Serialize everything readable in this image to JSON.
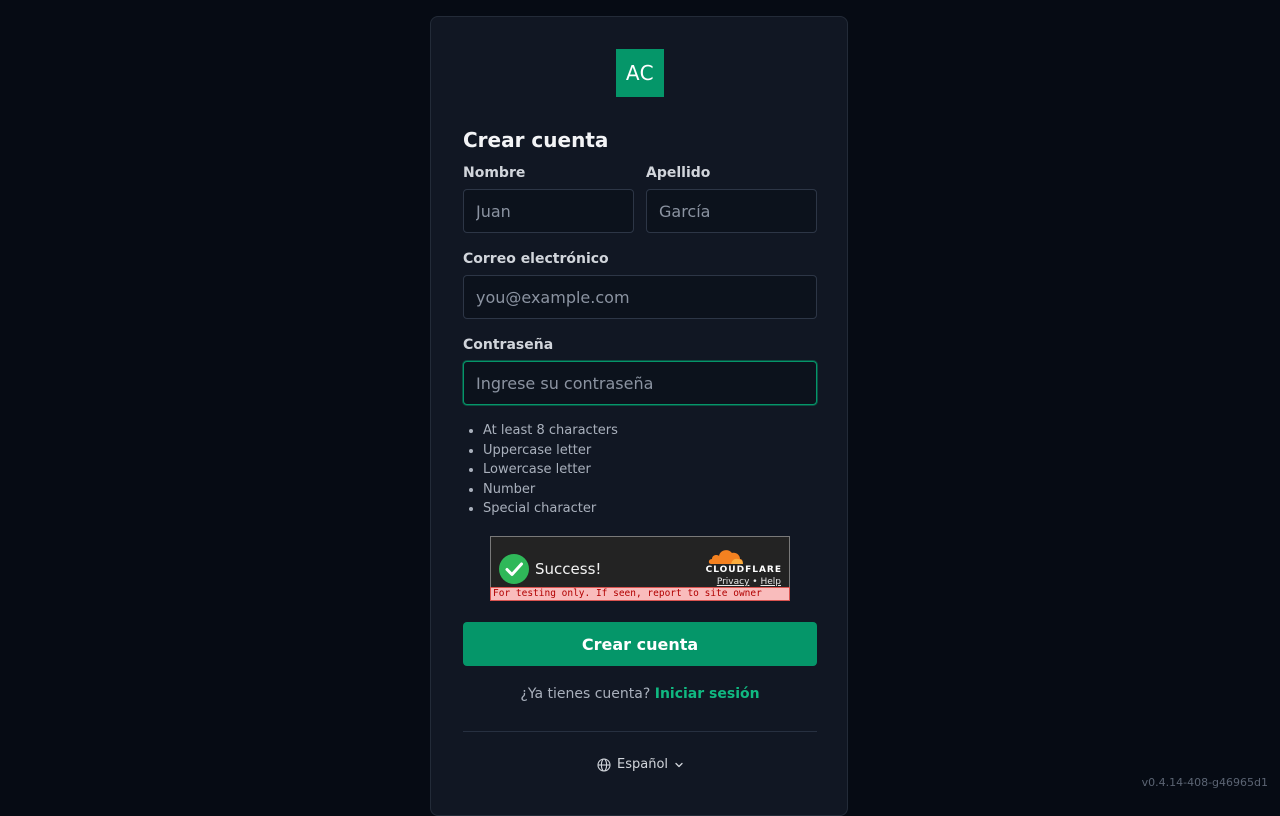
{
  "logo": {
    "text": "AC",
    "color": "#059669"
  },
  "form": {
    "title": "Crear cuenta",
    "first_name": {
      "label": "Nombre",
      "placeholder": "Juan",
      "value": ""
    },
    "last_name": {
      "label": "Apellido",
      "placeholder": "García",
      "value": ""
    },
    "email": {
      "label": "Correo electrónico",
      "placeholder": "you@example.com",
      "value": ""
    },
    "password": {
      "label": "Contraseña",
      "placeholder": "Ingrese su contraseña",
      "value": "",
      "focused": true
    },
    "password_rules": [
      "At least 8 characters",
      "Uppercase letter",
      "Lowercase letter",
      "Number",
      "Special character"
    ],
    "submit_label": "Crear cuenta"
  },
  "captcha": {
    "status": "Success!",
    "brand": "CLOUDFLARE",
    "privacy_label": "Privacy",
    "separator": "•",
    "help_label": "Help",
    "warning": "For testing only. If seen, report to site owner",
    "check_color": "#2fb859",
    "cloud_color": "#f48120"
  },
  "footer": {
    "signin_prompt": "¿Ya tienes cuenta?",
    "signin_link": "Iniciar sesión",
    "language": "Español",
    "globe_icon": "globe-icon",
    "chevron_icon": "chevron-down-icon",
    "version": "v0.4.14-408-g46965d1"
  }
}
